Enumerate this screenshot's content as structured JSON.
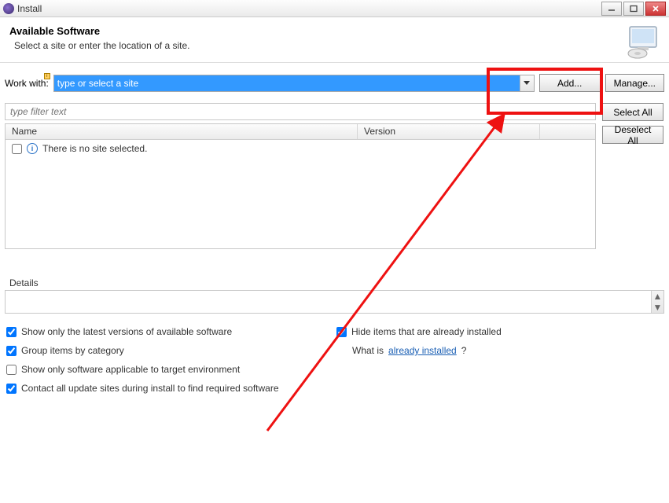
{
  "window": {
    "title": "Install"
  },
  "header": {
    "title": "Available Software",
    "subtitle": "Select a site or enter the location of a site."
  },
  "workwith": {
    "label": "Work with:",
    "value": "type or select a site",
    "add_label": "Add...",
    "manage_label": "Manage..."
  },
  "filter": {
    "placeholder": "type filter text"
  },
  "table": {
    "col_name": "Name",
    "col_version": "Version",
    "empty_msg": "There is no site selected."
  },
  "buttons": {
    "select_all": "Select All",
    "deselect_all": "Deselect All"
  },
  "details": {
    "label": "Details"
  },
  "checks": {
    "latest": "Show only the latest versions of available software",
    "group": "Group items by category",
    "applicable": "Show only software applicable to target environment",
    "contact": "Contact all update sites during install to find required software",
    "hide_installed": "Hide items that are already installed",
    "whatis_prefix": "What is ",
    "whatis_link": "already installed",
    "whatis_suffix": "?"
  }
}
